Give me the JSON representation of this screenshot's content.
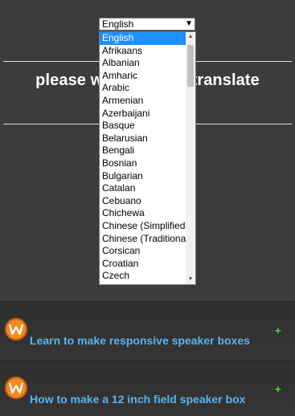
{
  "headline": {
    "left": "please wa",
    "right": "translate"
  },
  "language_select": {
    "selected": "English",
    "options": [
      "English",
      "Afrikaans",
      "Albanian",
      "Amharic",
      "Arabic",
      "Armenian",
      "Azerbaijani",
      "Basque",
      "Belarusian",
      "Bengali",
      "Bosnian",
      "Bulgarian",
      "Catalan",
      "Cebuano",
      "Chichewa",
      "Chinese (Simplified)",
      "Chinese (Traditional)",
      "Corsican",
      "Croatian",
      "Czech"
    ]
  },
  "articles": [
    {
      "title": "Learn to make responsive speaker boxes",
      "expand": "+",
      "icon": "brand-logo-icon"
    },
    {
      "title": "How to make a 12 inch field speaker box",
      "expand": "+",
      "icon": "brand-logo-icon"
    }
  ],
  "colors": {
    "background": "#3a3a3a",
    "link": "#5ab4ee",
    "plus": "#45e045",
    "selected_option": "#1e90ff",
    "logo": "#f08a24"
  }
}
